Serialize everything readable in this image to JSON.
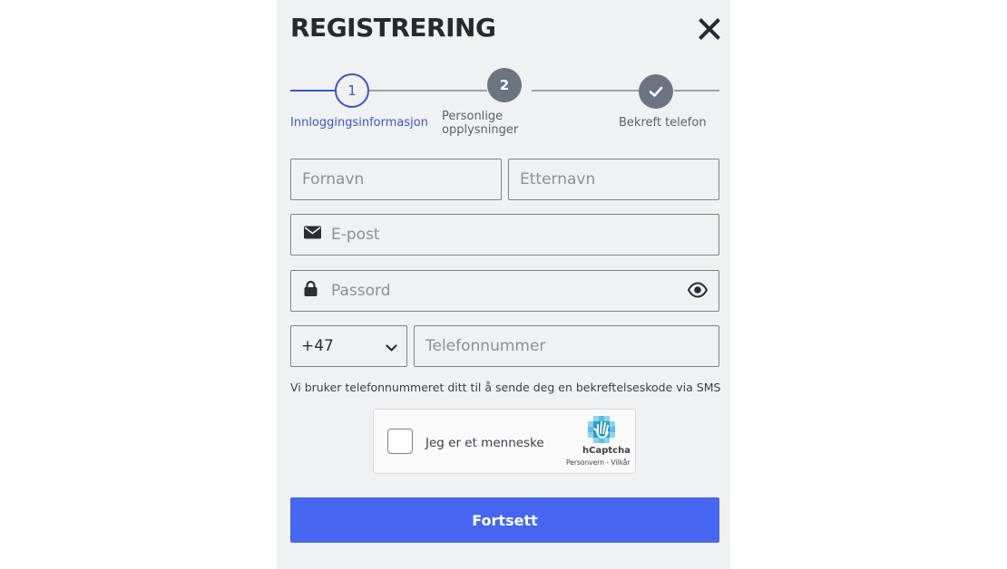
{
  "title": "REGISTRERING",
  "steps": [
    {
      "number": "1",
      "label": "Innloggingsinformasjon"
    },
    {
      "number": "2",
      "label_line1": "Personlige",
      "label_line2": "opplysninger"
    },
    {
      "icon": "checkmark-icon",
      "label": "Bekreft telefon"
    }
  ],
  "form": {
    "first_name_placeholder": "Fornavn",
    "last_name_placeholder": "Etternavn",
    "email_placeholder": "E-post",
    "password_placeholder": "Passord",
    "country_code": "+47",
    "phone_placeholder": "Telefonnummer",
    "phone_info": "Vi bruker telefonnummeret ditt til å sende deg en bekreftelseskode via SMS"
  },
  "captcha": {
    "label": "Jeg er et menneske",
    "brand": "hCaptcha",
    "links": "Personvern - Vilkår"
  },
  "submit_label": "Fortsett",
  "colors": {
    "accent": "#4466f0",
    "active_step": "#3a57c7",
    "inactive_step": "#6b7480",
    "panel_bg": "#f0f1f3"
  }
}
